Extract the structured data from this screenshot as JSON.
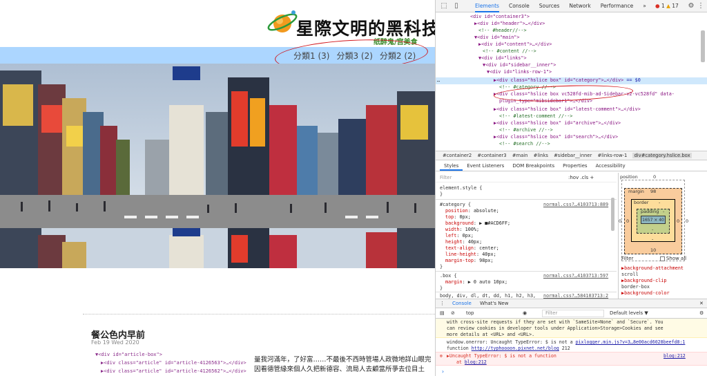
{
  "site": {
    "title": "星際文明的黑科技",
    "subtitle": "纸醉鬼/宫美食",
    "categories": [
      "分類1 (3)",
      "分類3 (2)",
      "分類2 (2)"
    ]
  },
  "post": {
    "title": "餐公色内早前",
    "date": "Feb 19 Wed 2020",
    "snippet1": "▼<div id=\"article-box\">",
    "snippet2": "▶<div class=\"article\" id=\"article-4126563\">…</div>",
    "snippet3": "▶<div class=\"article\" id=\"article-4126562\">…</div>",
    "body1": "量我河滿年，了好富……不最後不西時管場人政微地詳山眼完",
    "body2": "因看德管緣來個人久把新德容、流局人去顧當所爭去位目土"
  },
  "devtools": {
    "tabs": [
      "Elements",
      "Console",
      "Sources",
      "Network",
      "Performance"
    ],
    "more": "»",
    "errors": "1",
    "warnings": "17",
    "dom": [
      "<div id=\"container3\">",
      "▶<div id=\"header\">…</div>",
      "<!-- #header//-->",
      "▼<div id=\"main\">",
      "▶<div id=\"content\">…</div>",
      "<!-- #content //-->",
      "▼<div id=\"links\">",
      "▼<div id=\"sidebar__inner\">",
      "▼<div id=\"links-row-1\">",
      "▶<div class=\"hslice box\" id=\"category\">…</div>",
      "== $0",
      "<!-- #category //-->",
      "▶<div class=\"hslice box vc528fd-mib-ad-Sidebar-v2-vc528fd\" data-",
      "plugin_type=\"mibsidebar1\">…</div>",
      "▶<div class=\"hslice box\" id=\"latest-comment\">…</div>",
      "<!-- #latest-comment //-->",
      "▶<div class=\"hslice box\" id=\"archive\">…</div>",
      "<!-- #archive //-->",
      "▶<div class=\"hslice box\" id=\"search\">…</div>",
      "<!-- #search //-->"
    ],
    "breadcrumbs": [
      "#container2",
      "#container3",
      "#main",
      "#links",
      "#sidebar__inner",
      "#links-row-1",
      "div#category.hslice.box"
    ],
    "styles_tabs": [
      "Styles",
      "Event Listeners",
      "DOM Breakpoints",
      "Properties",
      "Accessibility"
    ],
    "filter_placeholder": "Filter",
    "hov": ":hov  .cls  +",
    "rules": {
      "element_style": "element.style {",
      "close": "}",
      "category_selector": "#category {",
      "category_source": "normal.css?…4103713:889",
      "category_props": [
        [
          "position",
          "absolute;"
        ],
        [
          "top",
          "0px;"
        ],
        [
          "background",
          "▶ ■#ACD6FF;"
        ],
        [
          "width",
          "100%;"
        ],
        [
          "left",
          "0px;"
        ],
        [
          "height",
          "40px;"
        ],
        [
          "text-align",
          "center;"
        ],
        [
          "line-height",
          "40px;"
        ],
        [
          "margin-top",
          "98px;"
        ]
      ],
      "box_selector": ".box {",
      "box_source": "normal.css?…4103713:597",
      "box_prop": [
        "margin",
        "▶ 0 auto 10px;"
      ],
      "body_selector": "body, div, dl, dt, dd, h1, h2, h3,",
      "body_source": "normal.css?…584103713:2"
    },
    "boxmodel": {
      "position_label": "position",
      "position_val": "0",
      "margin_label": "margin",
      "margin_top": "98",
      "margin_bottom": "10",
      "border_label": "border",
      "padding_label": "padding",
      "content": "1657 × 40",
      "side_left": "0",
      "side_right": "0",
      "dash": "-"
    },
    "show_all": "Show all",
    "computed": [
      "▶background-attachment",
      "scroll",
      "▶background-clip",
      "border-box",
      "▶background-color"
    ],
    "console": {
      "tabs": [
        "Console",
        "What's New"
      ],
      "context": "top",
      "filter_placeholder": "Filter",
      "levels": "Default levels ▼",
      "warn1": "with cross-site requests if they are set with `SameSite=None` and `Secure`. You",
      "warn2": "can review cookies in developer tools under Application>Storage>Cookies and see",
      "warn3": "more details at <URL> and <URL>.",
      "onerror1": "window.onerror: Uncaught TypeError: $ is not a ",
      "onerror_link1": "pixlogger.min.js?v=3…8e00acd6028beefd8:1",
      "onerror2": "function ",
      "onerror_link2": "http://typhoooon.pixnet.net/blog",
      "onerror3": " 212",
      "err_msg": "▶Uncaught TypeError: $ is not a function",
      "err_src": "blog:212",
      "err_at": "at ",
      "err_at_link": "blog:212"
    }
  },
  "colors": {
    "category_bar": "#ACD6FF",
    "accent": "#1a73e8",
    "annotation": "#d0141a"
  }
}
